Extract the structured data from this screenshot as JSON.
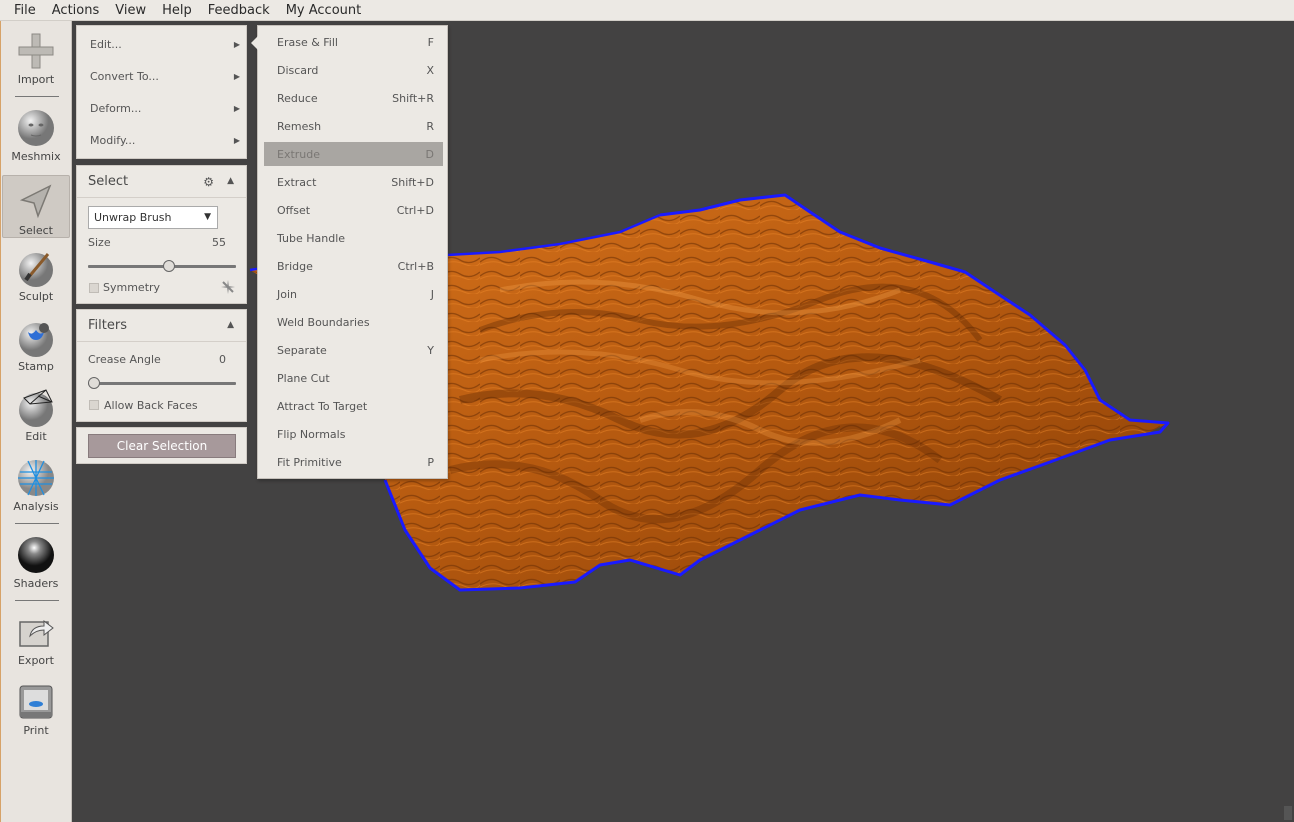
{
  "menubar": {
    "items": [
      "File",
      "Actions",
      "View",
      "Help",
      "Feedback",
      "My Account"
    ]
  },
  "toolbar": {
    "items": [
      {
        "label": "Import",
        "icon": "plus-icon"
      },
      {
        "label": "Meshmix",
        "icon": "face-sphere-icon"
      },
      {
        "label": "Select",
        "icon": "arrow-cursor-icon"
      },
      {
        "label": "Sculpt",
        "icon": "brush-sphere-icon"
      },
      {
        "label": "Stamp",
        "icon": "stamp-sphere-icon"
      },
      {
        "label": "Edit",
        "icon": "wireframe-sphere-icon"
      },
      {
        "label": "Analysis",
        "icon": "mesh-sphere-icon"
      },
      {
        "label": "Shaders",
        "icon": "shiny-sphere-icon"
      },
      {
        "label": "Export",
        "icon": "export-icon"
      },
      {
        "label": "Print",
        "icon": "printer-icon"
      }
    ]
  },
  "submenu": {
    "items": [
      "Edit...",
      "Convert To...",
      "Deform...",
      "Modify..."
    ]
  },
  "select_panel": {
    "title": "Select",
    "brush": "Unwrap Brush",
    "size_label": "Size",
    "size_value": "55",
    "size_fraction": 0.55,
    "symmetry_label": "Symmetry"
  },
  "filters_panel": {
    "title": "Filters",
    "crease_label": "Crease Angle",
    "crease_value": "0",
    "crease_fraction": 0.0,
    "backfaces_label": "Allow Back Faces"
  },
  "clear_button": "Clear Selection",
  "context_menu": {
    "items": [
      {
        "label": "Erase & Fill",
        "shortcut": "F"
      },
      {
        "label": "Discard",
        "shortcut": "X"
      },
      {
        "label": "Reduce",
        "shortcut": "Shift+R"
      },
      {
        "label": "Remesh",
        "shortcut": "R"
      },
      {
        "label": "Extrude",
        "shortcut": "D",
        "highlighted": true
      },
      {
        "label": "Extract",
        "shortcut": "Shift+D"
      },
      {
        "label": "Offset",
        "shortcut": "Ctrl+D"
      },
      {
        "label": "Tube Handle",
        "shortcut": ""
      },
      {
        "label": "Bridge",
        "shortcut": "Ctrl+B"
      },
      {
        "label": "Join",
        "shortcut": "J"
      },
      {
        "label": "Weld Boundaries",
        "shortcut": ""
      },
      {
        "label": "Separate",
        "shortcut": "Y"
      },
      {
        "label": "Plane Cut",
        "shortcut": ""
      },
      {
        "label": "Attract To Target",
        "shortcut": ""
      },
      {
        "label": "Flip Normals",
        "shortcut": ""
      },
      {
        "label": "Fit Primitive",
        "shortcut": "P"
      }
    ]
  },
  "colors": {
    "viewport_bg": "#434242",
    "terrain": "#c8620f",
    "selection_outline": "#1a1aff",
    "panel_bg": "#ece9e4"
  }
}
